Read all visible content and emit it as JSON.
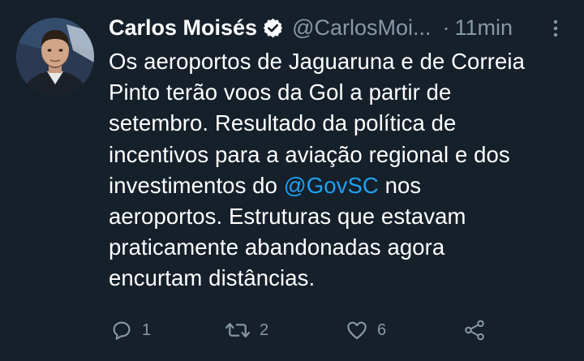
{
  "tweet": {
    "author_name": "Carlos Moisés",
    "handle": "@CarlosMoi...",
    "separator": "·",
    "time": "11min",
    "text_lines": [
      "Os aeroportos de Jaguaruna e de Correia",
      "Pinto terão voos da Gol a partir de",
      "setembro. Resultado da política de",
      "incentivos para a aviação regional e dos",
      "investimentos do ",
      "aeroportos. Estruturas que estavam",
      "praticamente abandonadas agora",
      "encurtam distâncias."
    ],
    "mention": "@GovSC",
    "mention_suffix": " nos",
    "replies": "1",
    "retweets": "2",
    "likes": "6"
  },
  "colors": {
    "background": "#15202b",
    "text": "#ffffff",
    "muted": "#8899a6",
    "link": "#1da1f2"
  },
  "icons": {
    "verified": "verified-badge-icon",
    "more": "more-vertical-icon",
    "reply": "reply-icon",
    "retweet": "retweet-icon",
    "like": "heart-icon",
    "share": "share-icon"
  }
}
